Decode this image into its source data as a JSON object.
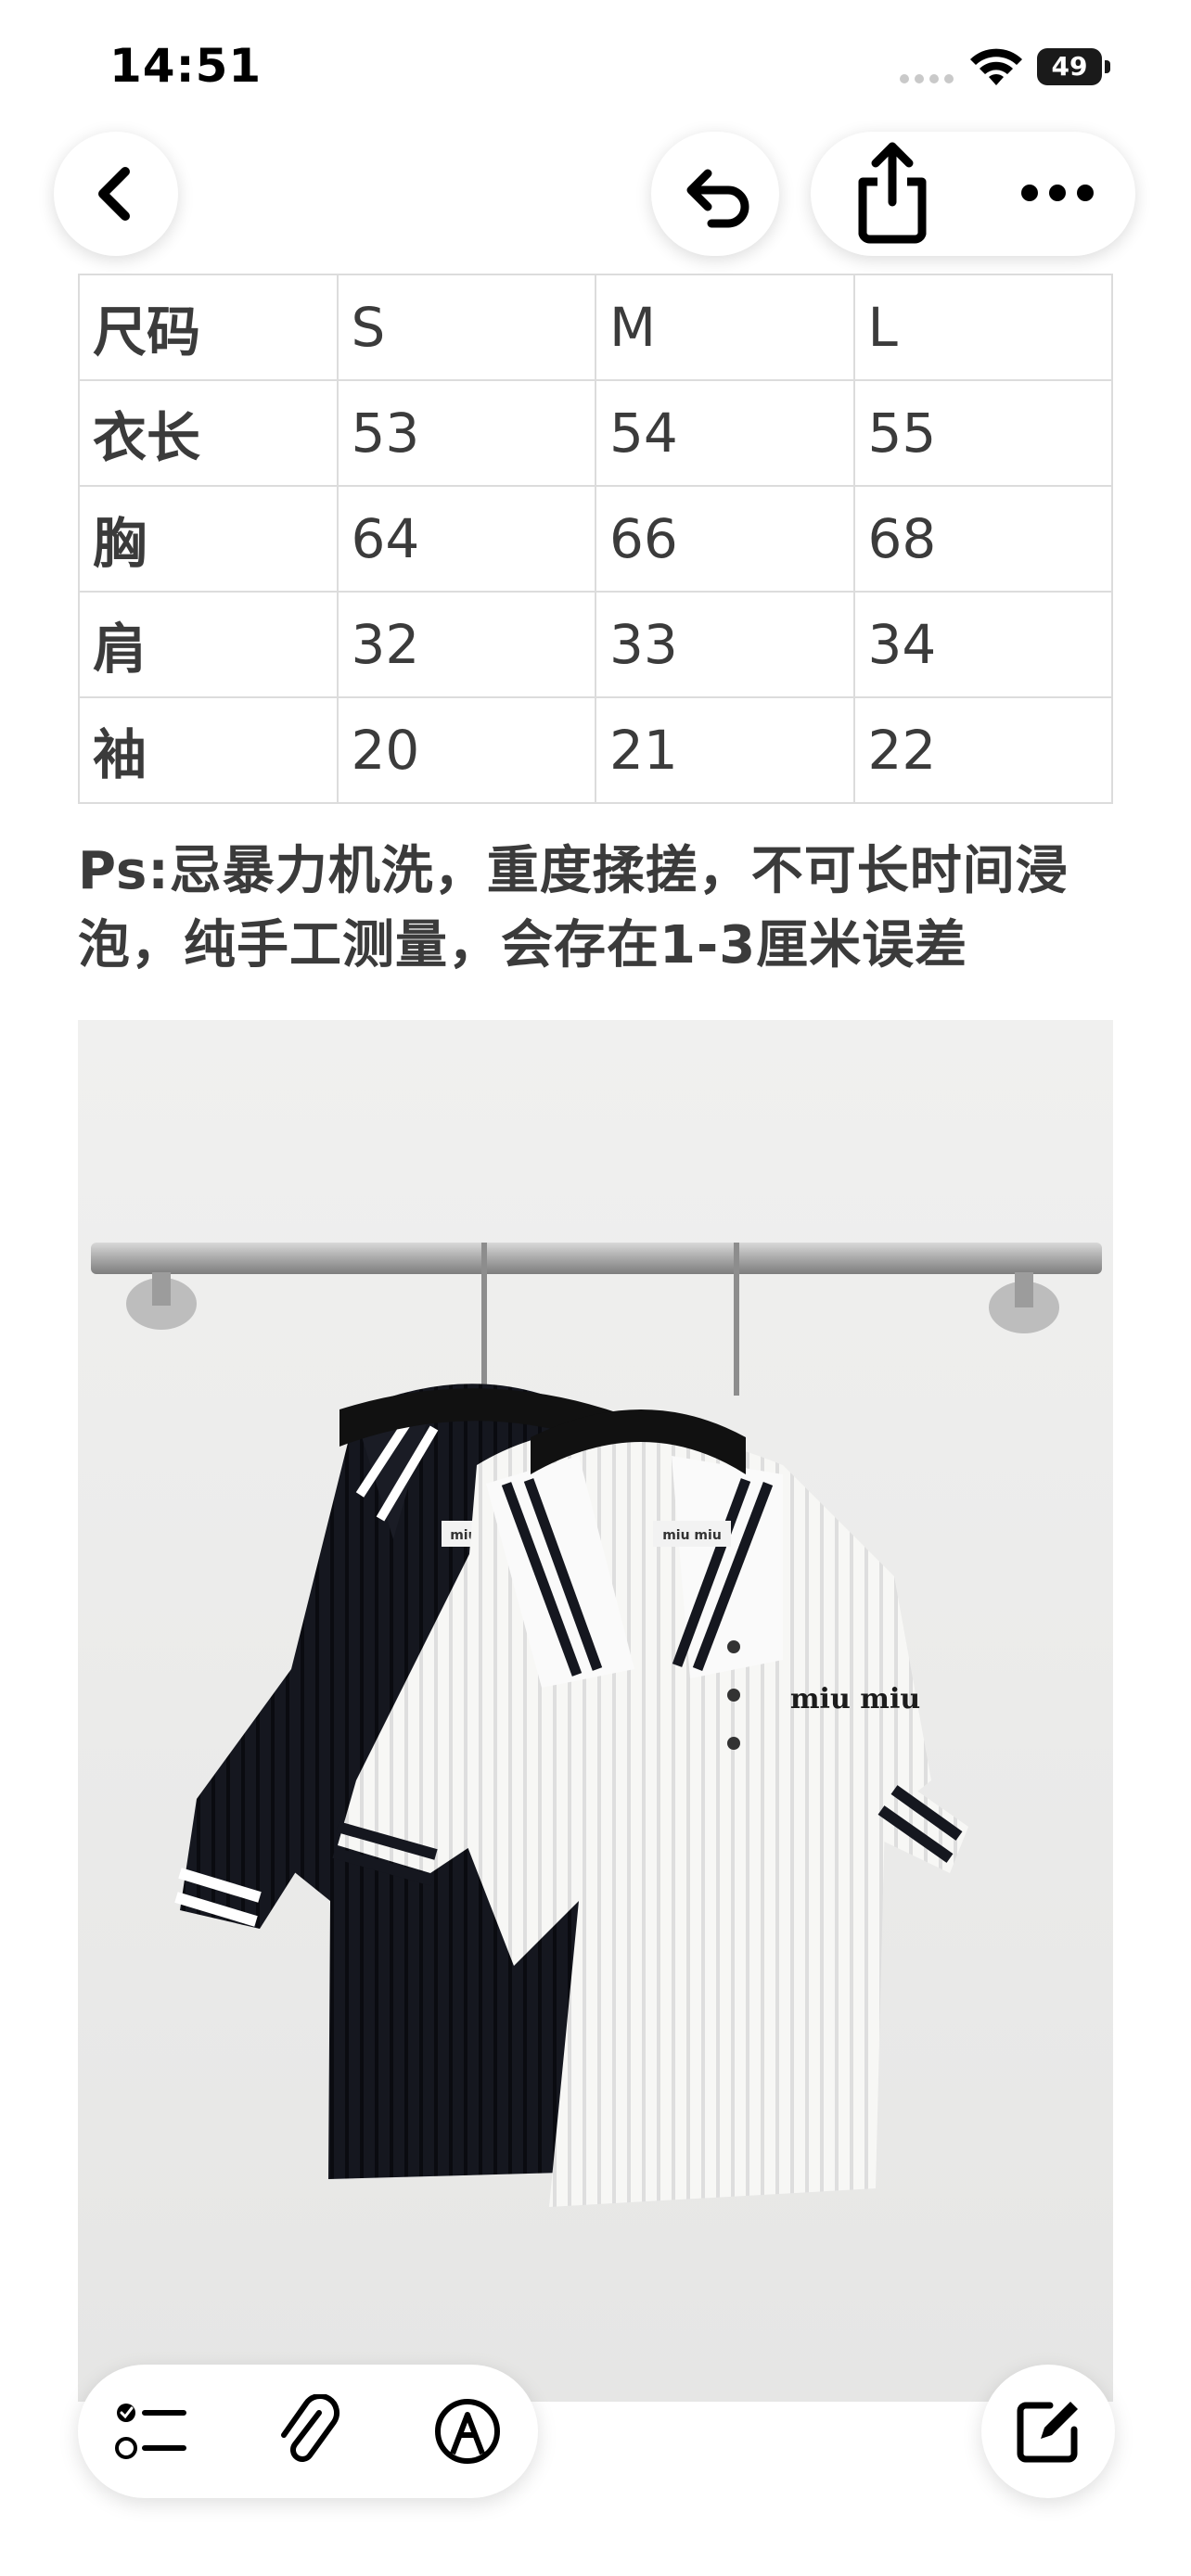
{
  "status_bar": {
    "time": "14:51",
    "battery": "49"
  },
  "nav": {
    "back_icon": "chevron-left-icon",
    "undo_icon": "undo-icon",
    "share_icon": "share-icon",
    "more_icon": "ellipsis-icon"
  },
  "size_table": {
    "header": [
      "尺码",
      "S",
      "M",
      "L"
    ],
    "rows": [
      [
        "衣长",
        "53",
        "54",
        "55"
      ],
      [
        "胸",
        "64",
        "66",
        "68"
      ],
      [
        "肩",
        "32",
        "33",
        "34"
      ],
      [
        "袖",
        "20",
        "21",
        "22"
      ]
    ]
  },
  "note": {
    "line1": "Ps:忌暴力机洗，重度揉搓，不可长时间浸",
    "line2": "泡，纯手工测量，会存在1-3厘米误差"
  },
  "photo": {
    "shirt_logo": "miu miu",
    "label_text": "miu miu"
  },
  "toolbar": {
    "checklist_icon": "checklist-icon",
    "attach_icon": "paperclip-icon",
    "markup_icon": "markup-pen-icon",
    "compose_icon": "compose-icon"
  },
  "colors": {
    "table_border": "#dcdcdc",
    "text": "#3b3b3b",
    "wall": "#ececec"
  }
}
